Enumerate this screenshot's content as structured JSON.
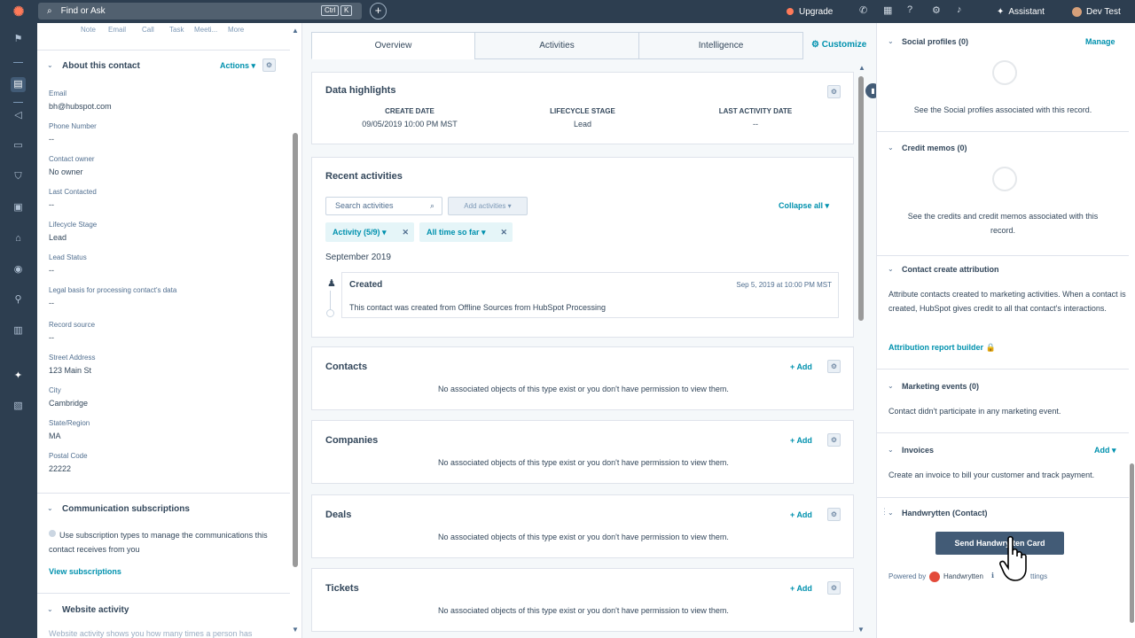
{
  "topbar": {
    "search_placeholder": "Find or Ask",
    "kbd_ctrl": "Ctrl",
    "kbd_k": "K",
    "upgrade": "Upgrade",
    "assistant": "Assistant",
    "account": "Dev Test"
  },
  "left": {
    "quick_actions": [
      "Note",
      "Email",
      "Call",
      "Task",
      "Meeti...",
      "More"
    ],
    "about_title": "About this contact",
    "actions_label": "Actions",
    "fields": [
      {
        "label": "Email",
        "value": "bh@hubspot.com"
      },
      {
        "label": "Phone Number",
        "value": "--"
      },
      {
        "label": "Contact owner",
        "value": "No owner"
      },
      {
        "label": "Last Contacted",
        "value": "--"
      },
      {
        "label": "Lifecycle Stage",
        "value": "Lead"
      },
      {
        "label": "Lead Status",
        "value": "--"
      },
      {
        "label": "Legal basis for processing contact's data",
        "value": "--"
      },
      {
        "label": "Record source",
        "value": "--"
      },
      {
        "label": "Street Address",
        "value": "123 Main St"
      },
      {
        "label": "City",
        "value": "Cambridge"
      },
      {
        "label": "State/Region",
        "value": "MA"
      },
      {
        "label": "Postal Code",
        "value": "22222"
      }
    ],
    "comm_title": "Communication subscriptions",
    "comm_text": "Use subscription types to manage the communications this contact receives from you",
    "view_subscriptions": "View subscriptions",
    "website_title": "Website activity",
    "website_text": "Website activity shows you how many times a person has"
  },
  "middle": {
    "tabs": [
      "Overview",
      "Activities",
      "Intelligence"
    ],
    "customize": "Customize",
    "highlights": {
      "title": "Data highlights",
      "items": [
        {
          "label": "CREATE DATE",
          "value": "09/05/2019 10:00 PM MST"
        },
        {
          "label": "LIFECYCLE STAGE",
          "value": "Lead"
        },
        {
          "label": "LAST ACTIVITY DATE",
          "value": "--"
        }
      ]
    },
    "recent": {
      "title": "Recent activities",
      "search_placeholder": "Search activities",
      "add_activities": "Add activities",
      "collapse_all": "Collapse all",
      "filter1": "Activity (5/9)",
      "filter2": "All time so far",
      "month": "September 2019",
      "activity_title": "Created",
      "activity_date": "Sep 5, 2019 at 10:00 PM MST",
      "activity_body": "This contact was created from Offline Sources from HubSpot Processing"
    },
    "assoc_cards": [
      {
        "title": "Contacts",
        "add": "Add",
        "empty": "No associated objects of this type exist or you don't have permission to view them."
      },
      {
        "title": "Companies",
        "add": "Add",
        "empty": "No associated objects of this type exist or you don't have permission to view them."
      },
      {
        "title": "Deals",
        "add": "Add",
        "empty": "No associated objects of this type exist or you don't have permission to view them."
      },
      {
        "title": "Tickets",
        "add": "Add",
        "empty": "No associated objects of this type exist or you don't have permission to view them."
      }
    ]
  },
  "right": {
    "social_title": "Social profiles (0)",
    "social_manage": "Manage",
    "social_text": "See the Social profiles associated with this record.",
    "credit_title": "Credit memos (0)",
    "credit_text": "See the credits and credit memos associated with this record.",
    "attr_title": "Contact create attribution",
    "attr_text": "Attribute contacts created to marketing activities. When a contact is created, HubSpot gives credit to all that contact's interactions.",
    "attr_link": "Attribution report builder",
    "events_title": "Marketing events (0)",
    "events_text": "Contact didn't participate in any marketing event.",
    "invoices_title": "Invoices",
    "invoices_add": "Add",
    "invoices_text": "Create an invoice to bill your customer and track payment.",
    "hw_title": "Handwrytten (Contact)",
    "hw_button": "Send Handwrytten Card",
    "powered_by": "Powered by",
    "hw_brand": "Handwrytten",
    "settings": "ttings"
  }
}
